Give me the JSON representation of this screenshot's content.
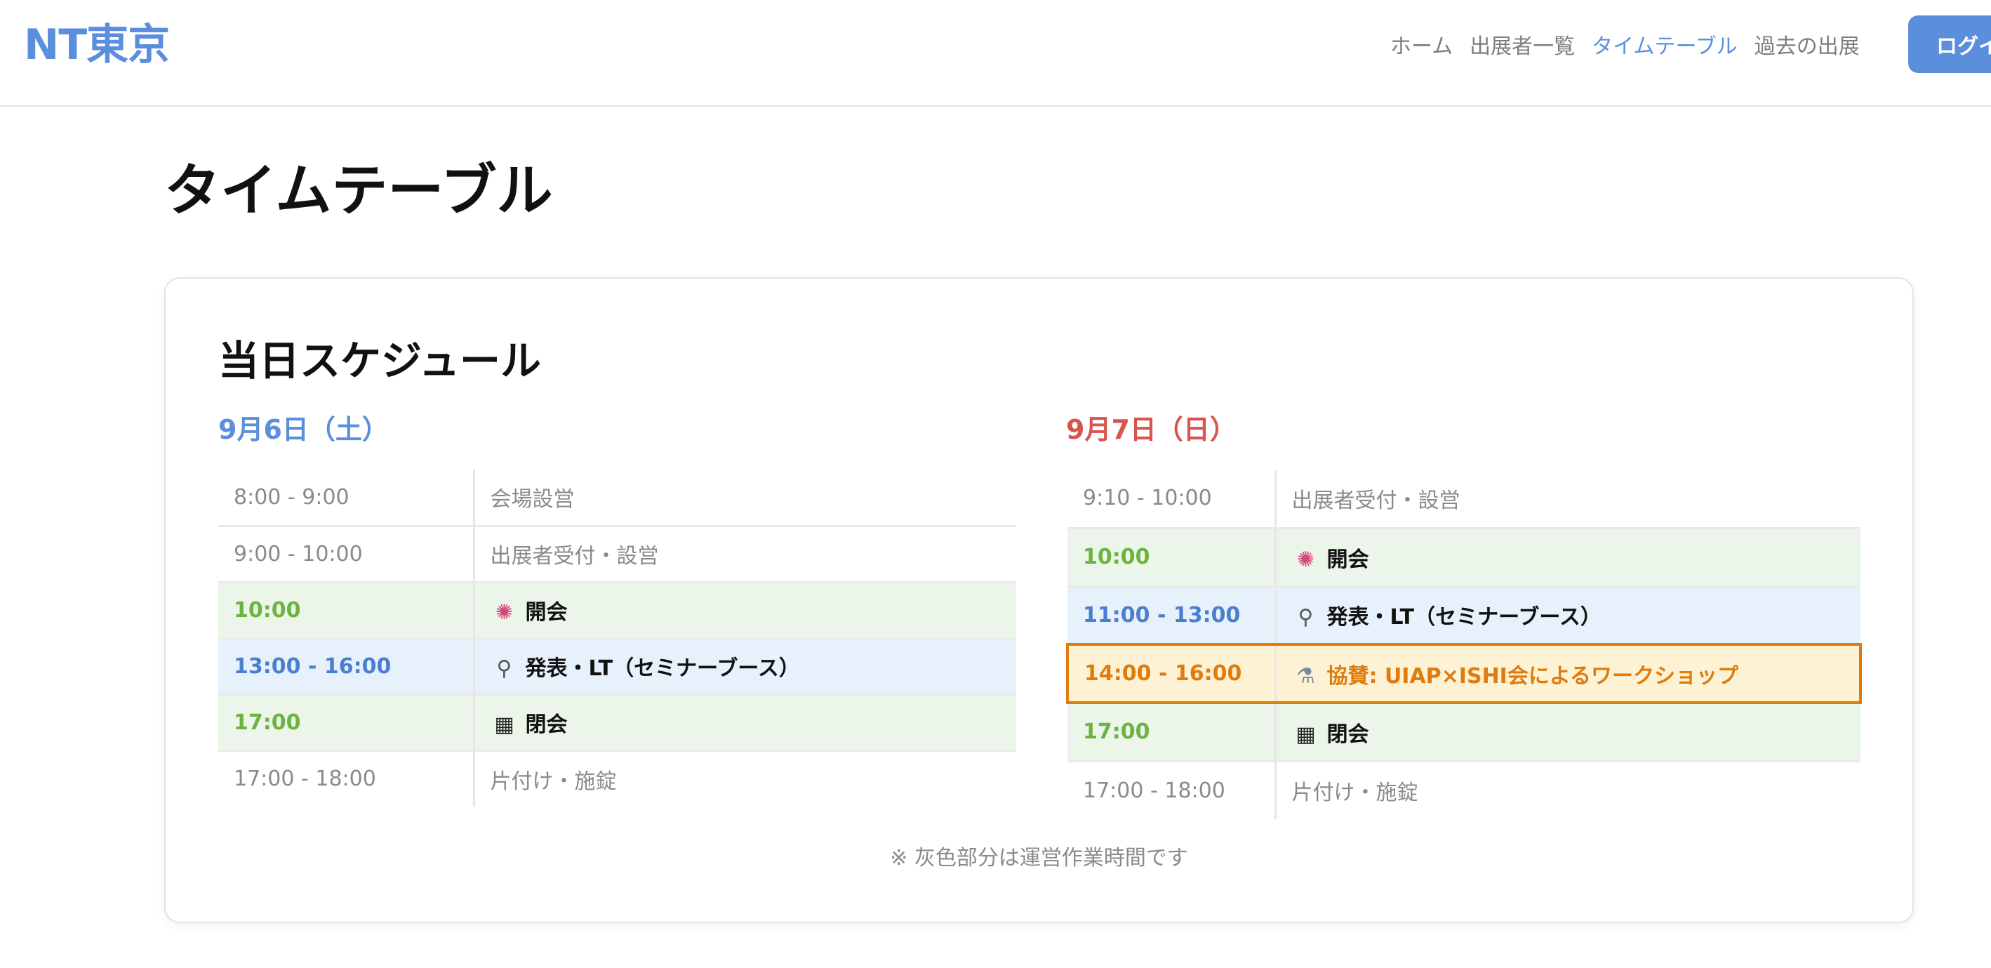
{
  "header": {
    "logo": "NT東京",
    "nav": [
      {
        "label": "ホーム",
        "active": false
      },
      {
        "label": "出展者一覧",
        "active": false
      },
      {
        "label": "タイムテーブル",
        "active": true
      },
      {
        "label": "過去の出展",
        "active": false
      }
    ],
    "login_label": "ログイン"
  },
  "page_title": "タイムテーブル",
  "schedule": {
    "title": "当日スケジュール",
    "days": [
      {
        "heading": "9月6日（土）",
        "rows": [
          {
            "time": "8:00 - 9:00",
            "event": "会場設営",
            "kind": "staff",
            "icon": ""
          },
          {
            "time": "9:00 - 10:00",
            "event": "出展者受付・設営",
            "kind": "staff",
            "icon": ""
          },
          {
            "time": "10:00",
            "event": "開会",
            "kind": "event",
            "icon": "party-popper-icon"
          },
          {
            "time": "13:00 - 16:00",
            "event": "発表・LT（セミナーブース）",
            "kind": "talk",
            "icon": "microphone-icon"
          },
          {
            "time": "17:00",
            "event": "閉会",
            "kind": "event",
            "icon": "checkered-flag-icon"
          },
          {
            "time": "17:00 - 18:00",
            "event": "片付け・施錠",
            "kind": "staff",
            "icon": ""
          }
        ]
      },
      {
        "heading": "9月7日（日）",
        "rows": [
          {
            "time": "9:10 - 10:00",
            "event": "出展者受付・設営",
            "kind": "staff",
            "icon": ""
          },
          {
            "time": "10:00",
            "event": "開会",
            "kind": "event",
            "icon": "party-popper-icon"
          },
          {
            "time": "11:00 - 13:00",
            "event": "発表・LT（セミナーブース）",
            "kind": "talk",
            "icon": "microphone-icon"
          },
          {
            "time": "14:00 - 16:00",
            "event": "協賛: UIAP×ISHI会によるワークショップ",
            "kind": "sponsor",
            "icon": "microscope-icon"
          },
          {
            "time": "17:00",
            "event": "閉会",
            "kind": "event",
            "icon": "checkered-flag-icon"
          },
          {
            "time": "17:00 - 18:00",
            "event": "片付け・施錠",
            "kind": "staff",
            "icon": ""
          }
        ]
      }
    ],
    "footnote": "※ 灰色部分は運営作業時間です"
  },
  "colors": {
    "accent_blue": "#5b8fdc",
    "sunday_red": "#d9534f",
    "event_green": "#6db33f",
    "sponsor_orange": "#e07b0e"
  }
}
